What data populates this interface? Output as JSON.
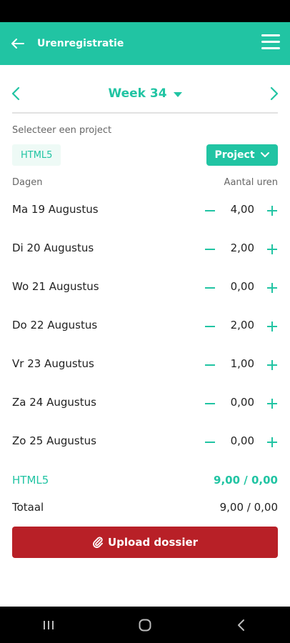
{
  "app": {
    "title": "Urenregistratie"
  },
  "week": {
    "label": "Week 34"
  },
  "project_select": {
    "label": "Selecteer een project",
    "selected_chip": "HTML5",
    "button_label": "Project"
  },
  "table": {
    "col_days": "Dagen",
    "col_hours": "Aantal uren",
    "rows": [
      {
        "day": "Ma 19 Augustus",
        "hours": "4,00"
      },
      {
        "day": "Di 20 Augustus",
        "hours": "2,00"
      },
      {
        "day": "Wo 21 Augustus",
        "hours": "0,00"
      },
      {
        "day": "Do 22 Augustus",
        "hours": "2,00"
      },
      {
        "day": "Vr 23 Augustus",
        "hours": "1,00"
      },
      {
        "day": "Za 24 Augustus",
        "hours": "0,00"
      },
      {
        "day": "Zo 25 Augustus",
        "hours": "0,00"
      }
    ]
  },
  "summary": {
    "project_name": "HTML5",
    "project_value": "9,00 / 0,00",
    "total_label": "Totaal",
    "total_value": "9,00 / 0,00"
  },
  "upload": {
    "label": "Upload dossier"
  },
  "colors": {
    "accent": "#21c4a3",
    "danger": "#b82027"
  }
}
